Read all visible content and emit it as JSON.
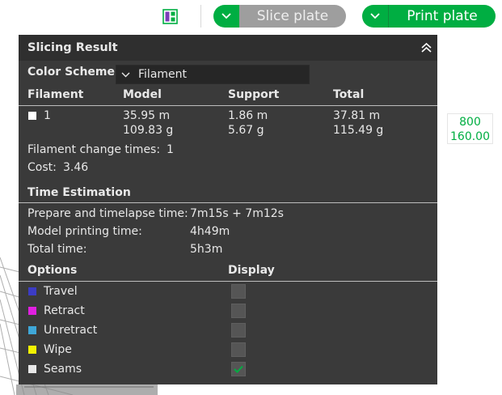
{
  "toolbar": {
    "slice_label": "Slice plate",
    "print_label": "Print plate"
  },
  "legend": {
    "value_top": "800",
    "value_bottom": "160.00"
  },
  "panel": {
    "title": "Slicing Result",
    "color_scheme_label": "Color Scheme",
    "color_scheme_value": "Filament",
    "table_headers": [
      "Filament",
      "Model",
      "Support",
      "Total"
    ],
    "filament_row": {
      "id": "1",
      "model_len": "35.95 m",
      "model_weight": "109.83 g",
      "support_len": "1.86 m",
      "support_weight": "5.67 g",
      "total_len": "37.81 m",
      "total_weight": "115.49 g"
    },
    "filament_change_label": "Filament change times:",
    "filament_change_value": "1",
    "cost_label": "Cost:",
    "cost_value": "3.46",
    "time_section_title": "Time Estimation",
    "times": [
      {
        "label": "Prepare and timelapse time:",
        "value": "7m15s + 7m12s"
      },
      {
        "label": "Model printing time:",
        "value": "4h49m"
      },
      {
        "label": "Total time:",
        "value": "5h3m"
      }
    ],
    "options_header": "Options",
    "display_header": "Display",
    "options": [
      {
        "label": "Travel",
        "color": "#3c3cc4",
        "checked": false
      },
      {
        "label": "Retract",
        "color": "#e020e0",
        "checked": false
      },
      {
        "label": "Unretract",
        "color": "#3fa7d8",
        "checked": false
      },
      {
        "label": "Wipe",
        "color": "#f2f200",
        "checked": false
      },
      {
        "label": "Seams",
        "color": "#e8e8e8",
        "checked": true
      }
    ]
  },
  "colors": {
    "accent": "#00ae42",
    "panel_bg": "#3a3a3a",
    "header_bg": "#2f2f2f"
  }
}
